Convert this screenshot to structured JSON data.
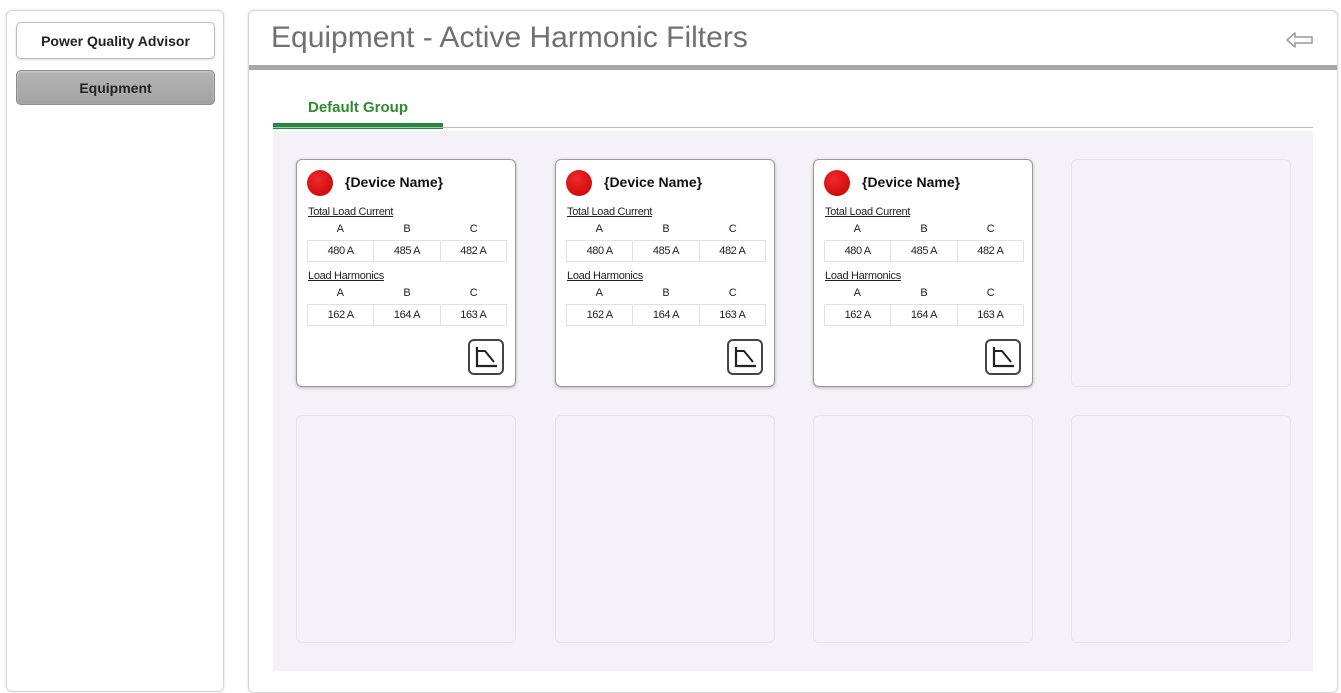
{
  "sidebar": {
    "items": [
      {
        "label": "Power Quality Advisor"
      },
      {
        "label": "Equipment"
      }
    ]
  },
  "header": {
    "title": "Equipment - Active Harmonic Filters",
    "back_icon": "back-arrow-icon"
  },
  "tabs": [
    {
      "label": "Default Group",
      "active": true
    }
  ],
  "colors": {
    "tab_accent": "#1e8c3a",
    "tab_text": "#2e8b2e",
    "status_alarm": "#d40000",
    "content_bg": "#f4f2f6"
  },
  "devices": [
    {
      "name": "{Device Name}",
      "status_icon": "status-alarm-icon",
      "total_load_label": "Total Load Current",
      "total_load_phases": [
        "A",
        "B",
        "C"
      ],
      "total_load_values": [
        "480 A",
        "485 A",
        "482 A"
      ],
      "harmonics_label": "Load Harmonics",
      "harmonics_phases": [
        "A",
        "B",
        "C"
      ],
      "harmonics_values": [
        "162 A",
        "164 A",
        "163 A"
      ],
      "trend_icon": "trend-chart-icon"
    },
    {
      "name": "{Device Name}",
      "status_icon": "status-alarm-icon",
      "total_load_label": "Total Load Current",
      "total_load_phases": [
        "A",
        "B",
        "C"
      ],
      "total_load_values": [
        "480 A",
        "485 A",
        "482 A"
      ],
      "harmonics_label": "Load Harmonics",
      "harmonics_phases": [
        "A",
        "B",
        "C"
      ],
      "harmonics_values": [
        "162 A",
        "164 A",
        "163 A"
      ],
      "trend_icon": "trend-chart-icon"
    },
    {
      "name": "{Device Name}",
      "status_icon": "status-alarm-icon",
      "total_load_label": "Total Load Current",
      "total_load_phases": [
        "A",
        "B",
        "C"
      ],
      "total_load_values": [
        "480 A",
        "485 A",
        "482 A"
      ],
      "harmonics_label": "Load Harmonics",
      "harmonics_phases": [
        "A",
        "B",
        "C"
      ],
      "harmonics_values": [
        "162 A",
        "164 A",
        "163 A"
      ],
      "trend_icon": "trend-chart-icon"
    }
  ]
}
